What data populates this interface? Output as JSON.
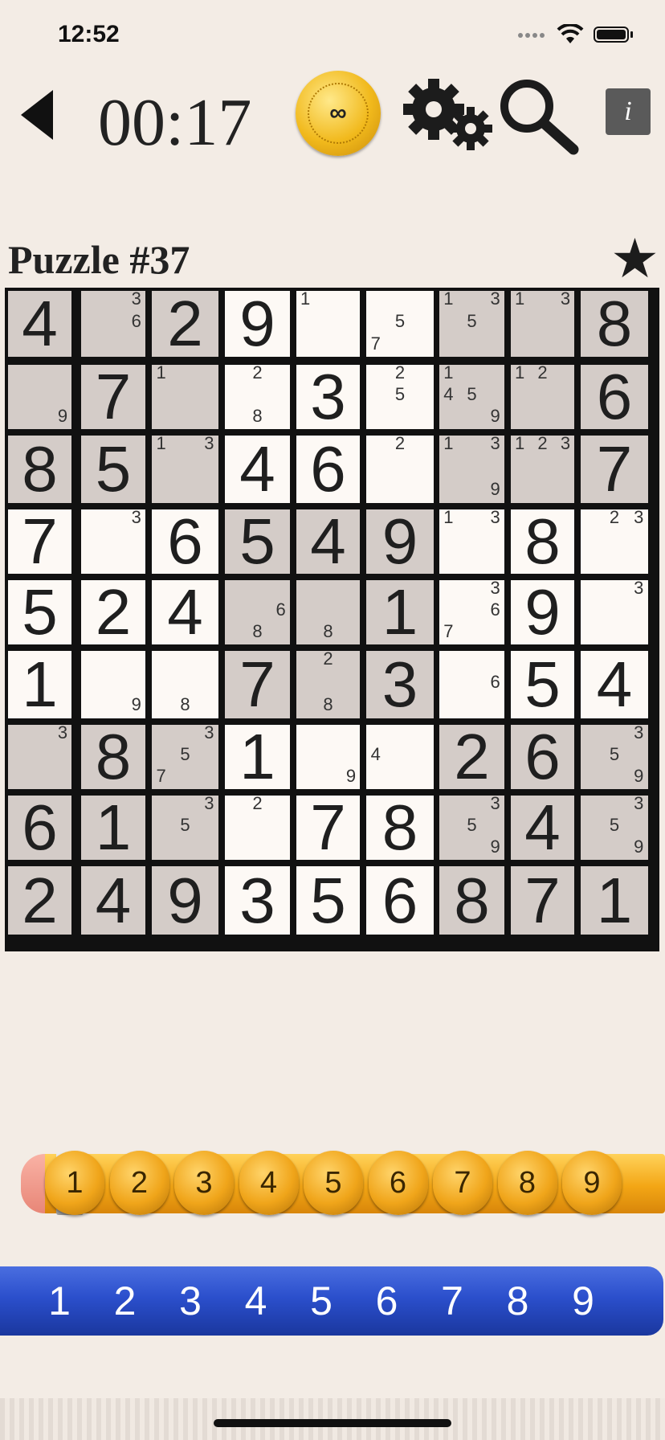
{
  "status": {
    "time": "12:52"
  },
  "toolbar": {
    "timer": "00:17",
    "coin_label": "∞",
    "info_label": "i"
  },
  "puzzle": {
    "title": "Puzzle #37",
    "rows": [
      [
        "4",
        "",
        "2",
        "9",
        "",
        "",
        "",
        "",
        "8"
      ],
      [
        "",
        "7",
        "",
        "",
        "3",
        "",
        "",
        "",
        "6"
      ],
      [
        "8",
        "5",
        "",
        "4",
        "6",
        "",
        "",
        "",
        "7"
      ],
      [
        "7",
        "",
        "6",
        "5",
        "4",
        "9",
        "",
        "8",
        ""
      ],
      [
        "5",
        "2",
        "4",
        "",
        "",
        "1",
        "",
        "9",
        ""
      ],
      [
        "1",
        "",
        "",
        "7",
        "",
        "3",
        "",
        "5",
        "4"
      ],
      [
        "",
        "8",
        "",
        "1",
        "",
        "",
        "2",
        "6",
        ""
      ],
      [
        "6",
        "1",
        "",
        "",
        "7",
        "8",
        "",
        "4",
        ""
      ],
      [
        "2",
        "4",
        "9",
        "3",
        "5",
        "6",
        "8",
        "7",
        "1"
      ]
    ],
    "candidates": [
      [
        [],
        [
          3,
          6
        ],
        [],
        [],
        [
          1
        ],
        [
          5,
          7
        ],
        [
          1,
          3,
          5
        ],
        [
          1,
          3
        ],
        []
      ],
      [
        [
          9
        ],
        [],
        [
          1
        ],
        [
          2,
          8
        ],
        [],
        [
          2,
          5
        ],
        [
          1,
          4,
          5,
          9
        ],
        [
          1,
          2
        ],
        []
      ],
      [
        [],
        [],
        [
          1,
          3
        ],
        [],
        [],
        [
          2
        ],
        [
          1,
          3,
          9
        ],
        [
          1,
          2,
          3
        ],
        []
      ],
      [
        [],
        [
          3
        ],
        [],
        [],
        [],
        [],
        [
          1,
          3
        ],
        [],
        [
          2,
          3
        ]
      ],
      [
        [],
        [],
        [],
        [
          6,
          8
        ],
        [
          8
        ],
        [],
        [
          3,
          6,
          7
        ],
        [],
        [
          3
        ]
      ],
      [
        [],
        [
          9
        ],
        [
          8
        ],
        [],
        [
          2,
          8
        ],
        [],
        [
          6
        ],
        [],
        []
      ],
      [
        [
          3
        ],
        [],
        [
          3,
          5,
          7
        ],
        [],
        [
          9
        ],
        [
          4
        ],
        [],
        [],
        [
          3,
          5,
          9
        ]
      ],
      [
        [],
        [],
        [
          3,
          5
        ],
        [
          2
        ],
        [],
        [],
        [
          3,
          5,
          9
        ],
        [],
        [
          3,
          5,
          9
        ]
      ],
      [
        [],
        [],
        [],
        [],
        [],
        [],
        [],
        [],
        []
      ]
    ],
    "shaded": [
      [
        1,
        1,
        1,
        0,
        0,
        0,
        1,
        1,
        1
      ],
      [
        1,
        1,
        1,
        0,
        0,
        0,
        1,
        1,
        1
      ],
      [
        1,
        1,
        1,
        0,
        0,
        0,
        1,
        1,
        1
      ],
      [
        0,
        0,
        0,
        1,
        1,
        1,
        0,
        0,
        0
      ],
      [
        0,
        0,
        0,
        1,
        1,
        1,
        0,
        0,
        0
      ],
      [
        0,
        0,
        0,
        1,
        1,
        1,
        0,
        0,
        0
      ],
      [
        1,
        1,
        1,
        0,
        0,
        0,
        1,
        1,
        1
      ],
      [
        1,
        1,
        1,
        0,
        0,
        0,
        1,
        1,
        1
      ],
      [
        1,
        1,
        1,
        0,
        0,
        0,
        1,
        1,
        1
      ]
    ]
  },
  "pencil_keys": [
    "1",
    "2",
    "3",
    "4",
    "5",
    "6",
    "7",
    "8",
    "9"
  ],
  "pen_keys": [
    "1",
    "2",
    "3",
    "4",
    "5",
    "6",
    "7",
    "8",
    "9"
  ],
  "colors": {
    "pencil": "#f3a615",
    "pen": "#2b4fcc",
    "shade": "#d4ccc8",
    "paper": "#f3ece5"
  }
}
